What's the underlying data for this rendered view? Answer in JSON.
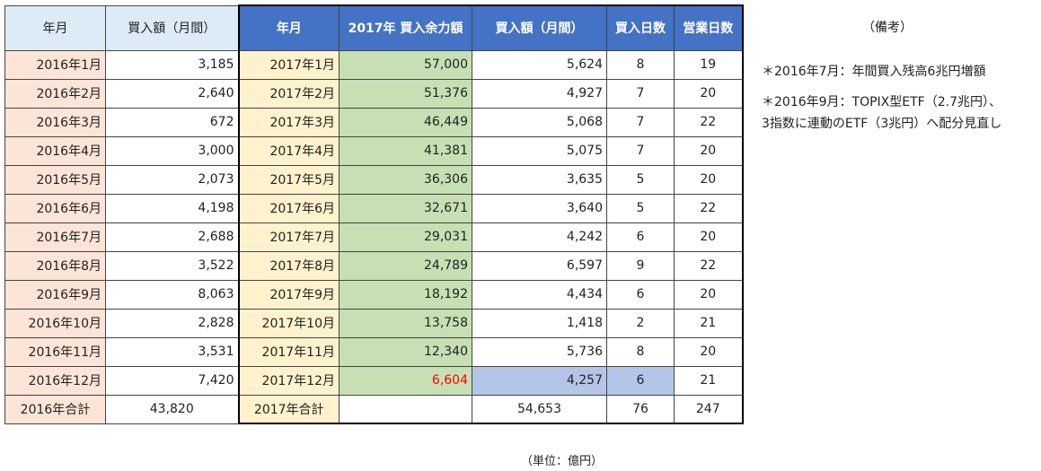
{
  "headers": {
    "ym_2016": "年月",
    "purchase_2016": "買入額（月間）",
    "ym_2017": "年月",
    "capacity_2017": "2017年 買入余力額",
    "purchase_2017": "買入額（月間）",
    "buy_days": "買入日数",
    "business_days": "営業日数"
  },
  "rows": [
    {
      "ym2016": "2016年1月",
      "amt2016": "3,185",
      "ym2017": "2017年1月",
      "capacity": "57,000",
      "amt2017": "5,624",
      "buy_days": "8",
      "biz_days": "19"
    },
    {
      "ym2016": "2016年2月",
      "amt2016": "2,640",
      "ym2017": "2017年2月",
      "capacity": "51,376",
      "amt2017": "4,927",
      "buy_days": "7",
      "biz_days": "20"
    },
    {
      "ym2016": "2016年3月",
      "amt2016": "672",
      "ym2017": "2017年3月",
      "capacity": "46,449",
      "amt2017": "5,068",
      "buy_days": "7",
      "biz_days": "22"
    },
    {
      "ym2016": "2016年4月",
      "amt2016": "3,000",
      "ym2017": "2017年4月",
      "capacity": "41,381",
      "amt2017": "5,075",
      "buy_days": "7",
      "biz_days": "20"
    },
    {
      "ym2016": "2016年5月",
      "amt2016": "2,073",
      "ym2017": "2017年5月",
      "capacity": "36,306",
      "amt2017": "3,635",
      "buy_days": "5",
      "biz_days": "20"
    },
    {
      "ym2016": "2016年6月",
      "amt2016": "4,198",
      "ym2017": "2017年6月",
      "capacity": "32,671",
      "amt2017": "3,640",
      "buy_days": "5",
      "biz_days": "22"
    },
    {
      "ym2016": "2016年7月",
      "amt2016": "2,688",
      "ym2017": "2017年7月",
      "capacity": "29,031",
      "amt2017": "4,242",
      "buy_days": "6",
      "biz_days": "20"
    },
    {
      "ym2016": "2016年8月",
      "amt2016": "3,522",
      "ym2017": "2017年8月",
      "capacity": "24,789",
      "amt2017": "6,597",
      "buy_days": "9",
      "biz_days": "22"
    },
    {
      "ym2016": "2016年9月",
      "amt2016": "8,063",
      "ym2017": "2017年9月",
      "capacity": "18,192",
      "amt2017": "4,434",
      "buy_days": "6",
      "biz_days": "20"
    },
    {
      "ym2016": "2016年10月",
      "amt2016": "2,828",
      "ym2017": "2017年10月",
      "capacity": "13,758",
      "amt2017": "1,418",
      "buy_days": "2",
      "biz_days": "21"
    },
    {
      "ym2016": "2016年11月",
      "amt2016": "3,531",
      "ym2017": "2017年11月",
      "capacity": "12,340",
      "amt2017": "5,736",
      "buy_days": "8",
      "biz_days": "20"
    },
    {
      "ym2016": "2016年12月",
      "amt2016": "7,420",
      "ym2017": "2017年12月",
      "capacity": "6,604",
      "amt2017": "4,257",
      "buy_days": "6",
      "biz_days": "21"
    }
  ],
  "totals": {
    "label2016": "2016年合計",
    "amt2016": "43,820",
    "label2017": "2017年合計",
    "capacity": "",
    "amt2017": "54,653",
    "buy_days": "76",
    "biz_days": "247"
  },
  "notes": {
    "title": "（備考）",
    "line1": "＊2016年7月：年間買入残高6兆円増額",
    "line2": "＊2016年9月：TOPIX型ETF（2.7兆円）、",
    "line3": "3指数に連動のETF（3兆円）へ配分見直し"
  },
  "unit_label": "（単位：億円）",
  "colors": {
    "header_light": "#ddebf7",
    "header_blue": "#4472c4",
    "ym2016_bg": "#fce4d6",
    "ym2017_bg": "#fff2cc",
    "capacity_bg": "#c6e0b4",
    "highlight_bg": "#b4c6e7",
    "alert_red": "#ff0000"
  }
}
